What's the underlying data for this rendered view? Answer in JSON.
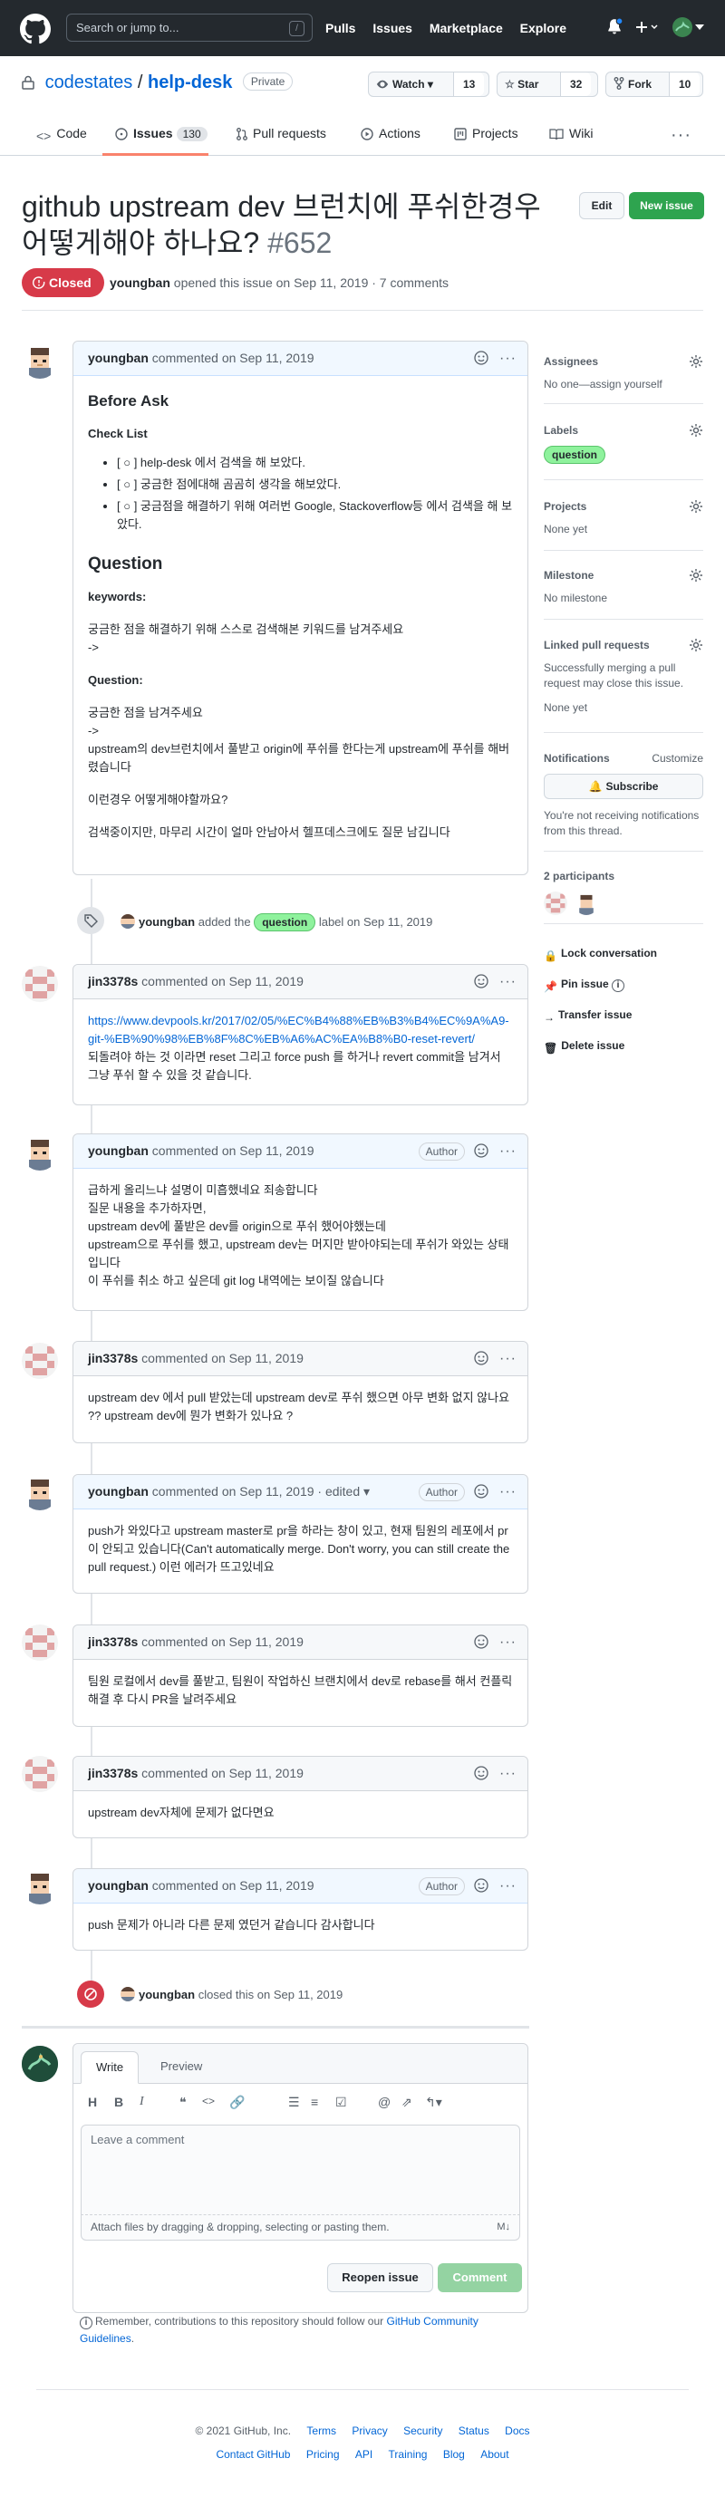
{
  "header": {
    "search_placeholder": "Search or jump to...",
    "search_hotkey": "/",
    "nav": [
      "Pulls",
      "Issues",
      "Marketplace",
      "Explore"
    ]
  },
  "repo": {
    "owner": "codestates",
    "separator": "/",
    "name": "help-desk",
    "visibility": "Private",
    "watch": {
      "label": "Watch",
      "count": "13"
    },
    "star": {
      "label": "Star",
      "count": "32"
    },
    "fork": {
      "label": "Fork",
      "count": "10"
    }
  },
  "tabs": [
    {
      "label": "Code"
    },
    {
      "label": "Issues",
      "count": "130"
    },
    {
      "label": "Pull requests"
    },
    {
      "label": "Actions"
    },
    {
      "label": "Projects"
    },
    {
      "label": "Wiki"
    }
  ],
  "issue": {
    "title": "github upstream dev 브런치에 푸쉬한경우 어떻게해야 하나요?",
    "number": "#652",
    "state": "Closed",
    "author": "youngban",
    "meta_rest": "opened this issue on Sep 11, 2019 · 7 comments",
    "edit_label": "Edit",
    "new_issue_label": "New issue"
  },
  "first_comment": {
    "author": "youngban",
    "meta": "commented on Sep 11, 2019",
    "h_before": "Before Ask",
    "checklist_title": "Check List",
    "checklist": [
      "[ ○ ] help-desk 에서 검색을 해 보았다.",
      "[ ○ ] 궁금한 점에대해 곰곰히 생각을 해보았다.",
      "[ ○ ] 궁금점을 해결하기 위해 여러번 Google, Stackoverflow등 에서 검색을 해 보았다."
    ],
    "h_question": "Question",
    "keywords_label": "keywords:",
    "keywords_text": "궁금한 점을 해결하기 위해 스스로 검색해본 키워드를 남겨주세요",
    "arrow1": "->",
    "question_label": "Question:",
    "question_text": "궁금한 점을 남겨주세요",
    "arrow2": "->",
    "question_body": "upstream의 dev브런치에서 풀받고 origin에 푸쉬를 한다는게 upstream에 푸쉬를 해버렸습니다",
    "question_follow": "이런경우 어떻게해야할까요?",
    "closing": "검색중이지만, 마무리 시간이 얼마 안남아서 헬프데스크에도 질문 남깁니다"
  },
  "label_event": {
    "actor": "youngban",
    "pre": "added the",
    "label": "question",
    "post": "label on Sep 11, 2019"
  },
  "comments": [
    {
      "author": "jin3378s",
      "meta": "commented on Sep 11, 2019",
      "link": "https://www.devpools.kr/2017/02/05/%EC%B4%88%EB%B3%B4%EC%9A%A9-git-%EB%90%98%EB%8F%8C%EB%A6%AC%EA%B8%B0-reset-revert/",
      "body": "되돌려야 하는 것 이라면 reset 그리고 force push 를 하거나 revert commit을 남겨서 그냥 푸쉬 할 수 있을 것 같습니다."
    },
    {
      "author": "youngban",
      "meta": "commented on Sep 11, 2019",
      "badge": "Author",
      "lines": [
        "급하게 올리느냐 설명이 미흡했네요 죄송합니다",
        "질문 내용을 추가하자면,",
        "upstream dev에 풀받은 dev를 origin으로 푸쉬 했어야했는데",
        "upstream으로 푸쉬를 했고, upstream dev는 머지만 받아야되는데 푸쉬가 와있는 상태입니다",
        "이 푸쉬를 취소 하고 싶은데 git log 내역에는 보이질 않습니다"
      ]
    },
    {
      "author": "jin3378s",
      "meta": "commented on Sep 11, 2019",
      "body": "upstream dev 에서 pull 받았는데 upstream dev로 푸쉬 했으면 아무 변화 없지 않나요 ?? upstream dev에 뭔가 변화가 있나요 ?"
    },
    {
      "author": "youngban",
      "meta": "commented on Sep 11, 2019 · edited",
      "badge": "Author",
      "body": "push가 와있다고 upstream master로 pr을 하라는 창이 있고, 현재 팀원의 레포에서 pr이 안되고 있습니다(Can't automatically merge. Don't worry, you can still create the pull request.) 이런 에러가 뜨고있네요"
    },
    {
      "author": "jin3378s",
      "meta": "commented on Sep 11, 2019",
      "body": "팀원 로컬에서 dev를 풀받고, 팀원이 작업하신 브랜치에서 dev로 rebase를 해서 컨플릭 해결 후 다시 PR을 날려주세요"
    },
    {
      "author": "jin3378s",
      "meta": "commented on Sep 11, 2019",
      "body": "upstream dev자체에 문제가 없다면요"
    },
    {
      "author": "youngban",
      "meta": "commented on Sep 11, 2019",
      "badge": "Author",
      "body": "push 문제가 아니라 다른 문제 였던거 같습니다 감사합니다"
    }
  ],
  "close_event": {
    "actor": "youngban",
    "text": "closed this on Sep 11, 2019"
  },
  "sidebar": {
    "assignees": {
      "title": "Assignees",
      "value": "No one—assign yourself"
    },
    "labels": {
      "title": "Labels",
      "value": "question"
    },
    "projects": {
      "title": "Projects",
      "value": "None yet"
    },
    "milestone": {
      "title": "Milestone",
      "value": "No milestone"
    },
    "linked_prs": {
      "title": "Linked pull requests",
      "desc": "Successfully merging a pull request may close this issue.",
      "value": "None yet"
    },
    "notifications": {
      "title": "Notifications",
      "customize": "Customize",
      "subscribe": "Subscribe",
      "desc": "You're not receiving notifications from this thread."
    },
    "participants": {
      "title": "2 participants"
    },
    "actions": [
      "Lock conversation",
      "Pin issue",
      "Transfer issue",
      "Delete issue"
    ]
  },
  "composer": {
    "tab_write": "Write",
    "tab_preview": "Preview",
    "placeholder": "Leave a comment",
    "attach": "Attach files by dragging & dropping, selecting or pasting them.",
    "reopen": "Reopen issue",
    "submit": "Comment",
    "remember_pre": "Remember, contributions to this repository should follow our",
    "remember_link": "GitHub Community Guidelines",
    "remember_post": "."
  },
  "footer": {
    "copyright": "© 2021 GitHub, Inc.",
    "row1": [
      "Terms",
      "Privacy",
      "Security",
      "Status",
      "Docs"
    ],
    "row2": [
      "Contact GitHub",
      "Pricing",
      "API",
      "Training",
      "Blog",
      "About"
    ]
  },
  "colors": {
    "closed": "#d73a49",
    "new_issue": "#2ea44f",
    "link": "#0366d6",
    "label": "#8ff29d"
  }
}
